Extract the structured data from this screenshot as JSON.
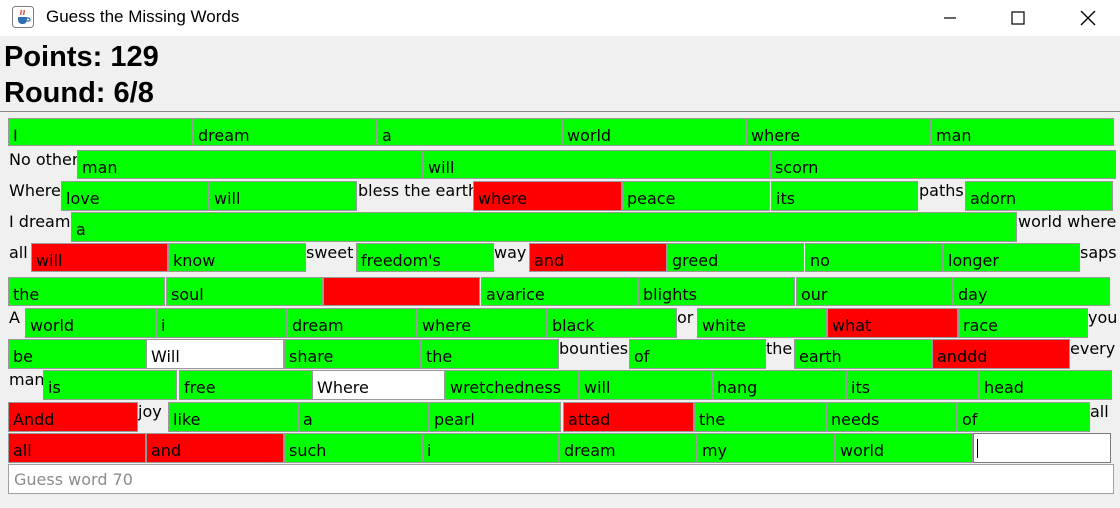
{
  "window": {
    "title": "Guess the Missing Words",
    "icon": "java-cup-icon",
    "controls": [
      "minimize-icon",
      "maximize-icon",
      "close-icon"
    ]
  },
  "status": {
    "points": "Points: 129",
    "round": "Round: 6/8"
  },
  "colors": {
    "correct": "#00ff00",
    "wrong": "#ff0000",
    "pending": "#ffffff"
  },
  "rows": [
    [
      {
        "kind": "field",
        "text": "I",
        "state": "correct"
      },
      {
        "kind": "field",
        "text": "dream",
        "state": "correct"
      },
      {
        "kind": "field",
        "text": "a",
        "state": "correct"
      },
      {
        "kind": "field",
        "text": "world",
        "state": "correct"
      },
      {
        "kind": "field",
        "text": "where",
        "state": "correct"
      },
      {
        "kind": "field",
        "text": "man",
        "state": "correct"
      }
    ],
    [
      {
        "kind": "label",
        "text": "No other"
      },
      {
        "kind": "field",
        "text": "man",
        "state": "correct"
      },
      {
        "kind": "field",
        "text": "will",
        "state": "correct"
      },
      {
        "kind": "field",
        "text": "scorn",
        "state": "correct"
      }
    ],
    [
      {
        "kind": "label",
        "text": "Where"
      },
      {
        "kind": "field",
        "text": "love",
        "state": "correct"
      },
      {
        "kind": "field",
        "text": "will",
        "state": "correct"
      },
      {
        "kind": "label",
        "text": "bless the earth"
      },
      {
        "kind": "field",
        "text": "where",
        "state": "wrong"
      },
      {
        "kind": "field",
        "text": "peace",
        "state": "correct"
      },
      {
        "kind": "field",
        "text": "its",
        "state": "correct"
      },
      {
        "kind": "label",
        "text": "paths"
      },
      {
        "kind": "field",
        "text": "adorn",
        "state": "correct"
      }
    ],
    [
      {
        "kind": "label",
        "text": "I dream"
      },
      {
        "kind": "field",
        "text": "a",
        "state": "correct"
      },
      {
        "kind": "label",
        "text": "world where"
      }
    ],
    [
      {
        "kind": "label",
        "text": "all"
      },
      {
        "kind": "field",
        "text": "will",
        "state": "wrong"
      },
      {
        "kind": "field",
        "text": "know",
        "state": "correct"
      },
      {
        "kind": "label",
        "text": "sweet"
      },
      {
        "kind": "field",
        "text": "freedom's",
        "state": "correct"
      },
      {
        "kind": "label",
        "text": "way"
      },
      {
        "kind": "field",
        "text": "and",
        "state": "wrong"
      },
      {
        "kind": "field",
        "text": "greed",
        "state": "correct"
      },
      {
        "kind": "field",
        "text": "no",
        "state": "correct"
      },
      {
        "kind": "field",
        "text": "longer",
        "state": "correct"
      },
      {
        "kind": "label",
        "text": "saps"
      }
    ],
    [
      {
        "kind": "field",
        "text": "the",
        "state": "correct"
      },
      {
        "kind": "field",
        "text": "soul",
        "state": "correct"
      },
      {
        "kind": "field",
        "text": "",
        "state": "wrong"
      },
      {
        "kind": "field",
        "text": "avarice",
        "state": "correct"
      },
      {
        "kind": "field",
        "text": "blights",
        "state": "correct"
      },
      {
        "kind": "field",
        "text": "our",
        "state": "correct"
      },
      {
        "kind": "field",
        "text": "day",
        "state": "correct"
      }
    ],
    [
      {
        "kind": "label",
        "text": "A"
      },
      {
        "kind": "field",
        "text": "world",
        "state": "correct"
      },
      {
        "kind": "field",
        "text": "i",
        "state": "correct"
      },
      {
        "kind": "field",
        "text": "dream",
        "state": "correct"
      },
      {
        "kind": "field",
        "text": "where",
        "state": "correct"
      },
      {
        "kind": "field",
        "text": "black",
        "state": "correct"
      },
      {
        "kind": "label",
        "text": "or"
      },
      {
        "kind": "field",
        "text": "white",
        "state": "correct"
      },
      {
        "kind": "field",
        "text": "what",
        "state": "wrong"
      },
      {
        "kind": "field",
        "text": "race",
        "state": "correct"
      },
      {
        "kind": "label",
        "text": "you"
      }
    ],
    [
      {
        "kind": "field",
        "text": "be",
        "state": "correct"
      },
      {
        "kind": "field",
        "text": "Will",
        "state": "pending"
      },
      {
        "kind": "field",
        "text": "share",
        "state": "correct"
      },
      {
        "kind": "field",
        "text": "the",
        "state": "correct"
      },
      {
        "kind": "label",
        "text": "bounties"
      },
      {
        "kind": "field",
        "text": "of",
        "state": "correct"
      },
      {
        "kind": "label",
        "text": "the"
      },
      {
        "kind": "field",
        "text": "earth",
        "state": "correct"
      },
      {
        "kind": "field",
        "text": "anddd",
        "state": "wrong"
      },
      {
        "kind": "label",
        "text": "every"
      }
    ],
    [
      {
        "kind": "label",
        "text": "man"
      },
      {
        "kind": "field",
        "text": "is",
        "state": "correct"
      },
      {
        "kind": "field",
        "text": "free",
        "state": "correct"
      },
      {
        "kind": "field",
        "text": "Where",
        "state": "pending"
      },
      {
        "kind": "field",
        "text": "wretchedness",
        "state": "correct"
      },
      {
        "kind": "field",
        "text": "will",
        "state": "correct"
      },
      {
        "kind": "field",
        "text": "hang",
        "state": "correct"
      },
      {
        "kind": "field",
        "text": "its",
        "state": "correct"
      },
      {
        "kind": "field",
        "text": "head",
        "state": "correct"
      }
    ],
    [
      {
        "kind": "field",
        "text": "Andd",
        "state": "wrong"
      },
      {
        "kind": "label",
        "text": "joy"
      },
      {
        "kind": "field",
        "text": "like",
        "state": "correct"
      },
      {
        "kind": "field",
        "text": "a",
        "state": "correct"
      },
      {
        "kind": "field",
        "text": "pearl",
        "state": "correct"
      },
      {
        "kind": "field",
        "text": "attad",
        "state": "wrong"
      },
      {
        "kind": "field",
        "text": "the",
        "state": "correct"
      },
      {
        "kind": "field",
        "text": "needs",
        "state": "correct"
      },
      {
        "kind": "field",
        "text": "of",
        "state": "correct"
      },
      {
        "kind": "label",
        "text": "all"
      }
    ],
    [
      {
        "kind": "field",
        "text": "all",
        "state": "wrong"
      },
      {
        "kind": "field",
        "text": "and",
        "state": "wrong"
      },
      {
        "kind": "field",
        "text": "such",
        "state": "correct"
      },
      {
        "kind": "field",
        "text": "i",
        "state": "correct"
      },
      {
        "kind": "field",
        "text": "dream",
        "state": "correct"
      },
      {
        "kind": "field",
        "text": "my",
        "state": "correct"
      },
      {
        "kind": "field",
        "text": "world",
        "state": "correct"
      },
      {
        "kind": "field",
        "text": "",
        "state": "active"
      }
    ]
  ],
  "guess_input": {
    "value": "",
    "placeholder": "Guess word 70"
  }
}
